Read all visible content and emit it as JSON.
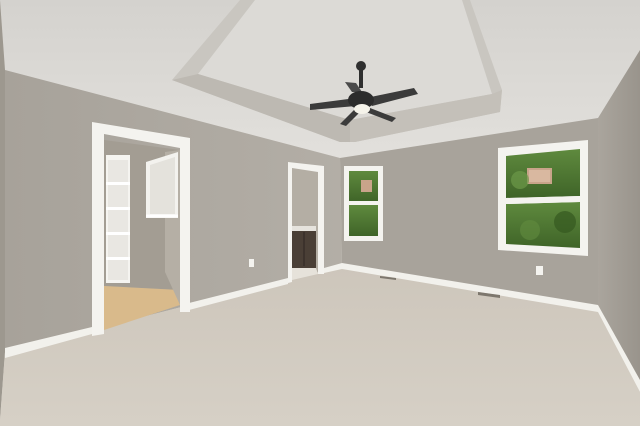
{
  "scene": {
    "description_label": "",
    "colors": {
      "wall": "#a9a49c",
      "wall_light": "#b8b3ab",
      "ceiling": "#d8d6d2",
      "tray_face": "#c7c4be",
      "trim": "#f4f3ef",
      "carpet": "#cfc8bd",
      "closet_floor": "#d8b98a",
      "greenery": "#4f7a35",
      "fan_body": "#3a3a3a"
    },
    "icons": [
      "ceiling-fan-icon",
      "window-icon",
      "door-icon",
      "shelving-icon",
      "outlet-icon",
      "vent-icon"
    ]
  }
}
